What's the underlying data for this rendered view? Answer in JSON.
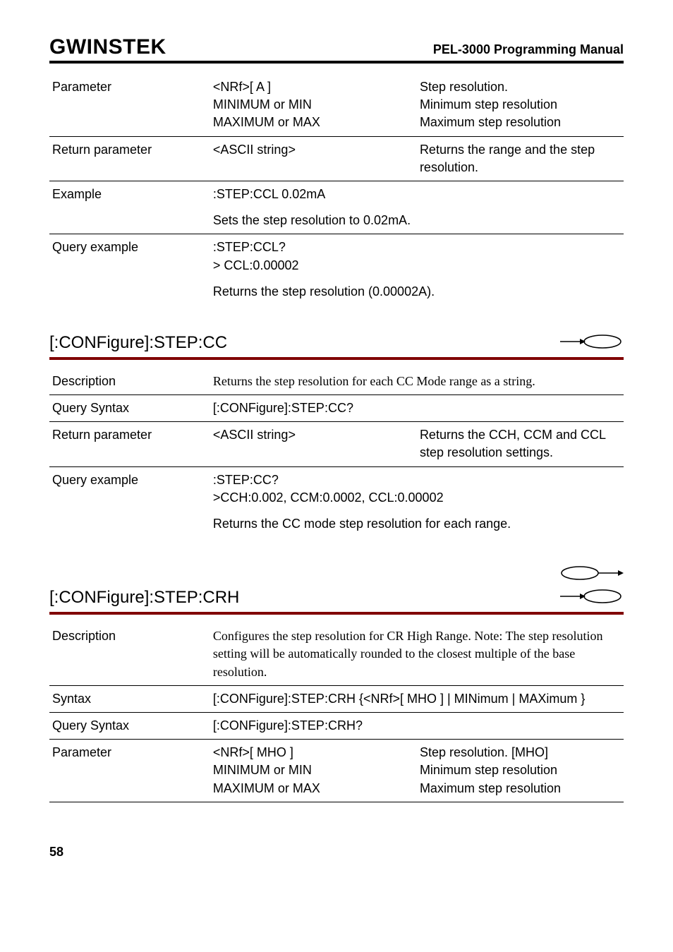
{
  "header": {
    "logo": "GWINSTEK",
    "manual": "PEL-3000 Programming Manual"
  },
  "tableTop": {
    "parameterLabel": "Parameter",
    "paramVals": "<NRf>[ A ]\nMINIMUM or MIN\nMAXIMUM or MAX",
    "paramDesc": "Step resolution.\nMinimum step resolution\nMaximum step resolution",
    "returnParamLabel": "Return parameter",
    "returnParamVal": "<ASCII string>",
    "returnParamDesc": "Returns the range and the step resolution.",
    "exampleLabel": "Example",
    "exampleVal": ":STEP:CCL 0.02mA",
    "exampleDesc": "Sets the step resolution to 0.02mA.",
    "queryExampleLabel": "Query example",
    "queryExampleVal": ":STEP:CCL?\n> CCL:0.00002",
    "queryExampleDesc": "Returns the step resolution (0.00002A)."
  },
  "sectionCC": {
    "title": "[:CONFigure]:STEP:CC",
    "descLabel": "Description",
    "desc": "Returns the step resolution for each CC Mode range as a string.",
    "querySyntaxLabel": "Query Syntax",
    "querySyntax": "[:CONFigure]:STEP:CC?",
    "returnParamLabel": "Return parameter",
    "returnParamVal": "<ASCII string>",
    "returnParamDesc": "Returns the CCH, CCM and CCL step resolution settings.",
    "queryExampleLabel": "Query example",
    "queryExampleVal": ":STEP:CC?\n>CCH:0.002, CCM:0.0002, CCL:0.00002",
    "queryExampleDesc": "Returns the CC mode step resolution for each range."
  },
  "sectionCRH": {
    "title": "[:CONFigure]:STEP:CRH",
    "descLabel": "Description",
    "desc": "Configures the step resolution for CR High Range. Note: The step resolution setting will be automatically rounded to the closest multiple of the base resolution.",
    "syntaxLabel": "Syntax",
    "syntax": "[:CONFigure]:STEP:CRH {<NRf>[ MHO ]  | MINimum | MAXimum }",
    "querySyntaxLabel": "Query Syntax",
    "querySyntax": "[:CONFigure]:STEP:CRH?",
    "parameterLabel": "Parameter",
    "paramVals": "<NRf>[ MHO ]\nMINIMUM or MIN\nMAXIMUM or MAX",
    "paramDesc": "Step resolution. [MHO]\nMinimum step resolution\nMaximum step resolution"
  },
  "pageNumber": "58"
}
